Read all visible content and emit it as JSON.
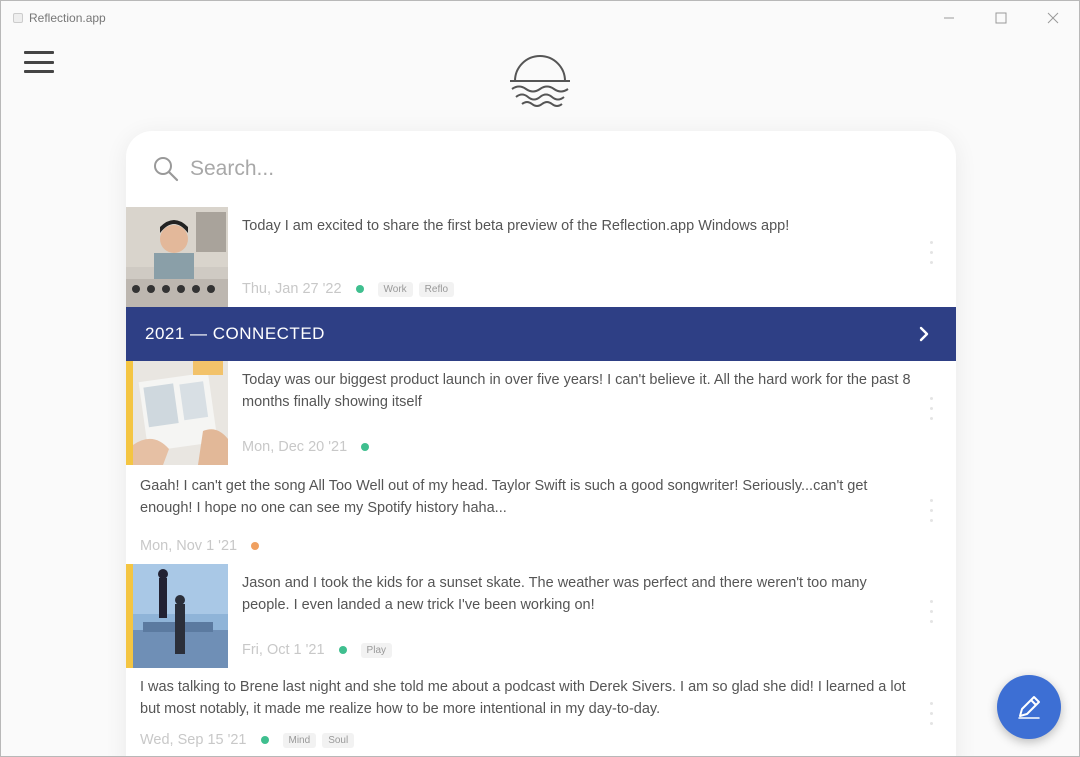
{
  "window": {
    "title": "Reflection.app"
  },
  "search": {
    "placeholder": "Search..."
  },
  "entries_top": [
    {
      "text": "Today I am excited to share the first beta preview of the Reflection.app Windows app!",
      "date": "Thu, Jan 27 '22",
      "dot": "green",
      "tags": [
        "Work",
        "Reflo"
      ]
    }
  ],
  "year_banner": {
    "label": "2021 — CONNECTED"
  },
  "entries": [
    {
      "text": "Today was our biggest product launch in over five years! I can't believe it. All the hard work for the past 8 months finally showing itself",
      "date": "Mon, Dec 20 '21",
      "dot": "green",
      "tags": []
    },
    {
      "text": "Gaah! I can't get the song All Too Well out of my head. Taylor Swift is such a good songwriter! Seriously...can't get enough! I hope no one can see my Spotify history haha...",
      "date": "Mon, Nov 1 '21",
      "dot": "orange",
      "tags": []
    },
    {
      "text": "Jason and I took the kids for a sunset skate. The weather was perfect and there weren't too many people. I even landed a new trick I've been working on!",
      "date": "Fri, Oct 1 '21",
      "dot": "green",
      "tags": [
        "Play"
      ]
    },
    {
      "text": "I was talking to Brene last night and she told me about a podcast with Derek Sivers. I am so glad she did! I learned a lot but most notably, it made me realize how to be more intentional in my day-to-day.",
      "date": "Wed, Sep 15 '21",
      "dot": "green",
      "tags": [
        "Mind",
        "Soul"
      ]
    }
  ],
  "colors": {
    "banner": "#2e3f85",
    "accent": "#f4c542",
    "fab": "#3d6fd4",
    "dot_green": "#3fbf8f",
    "dot_orange": "#f0a060"
  },
  "icons": {
    "menu": "hamburger-icon",
    "logo": "sunset-waves-logo",
    "search": "search-icon",
    "banner": "chevron-right-icon",
    "fab": "pencil-icon"
  }
}
